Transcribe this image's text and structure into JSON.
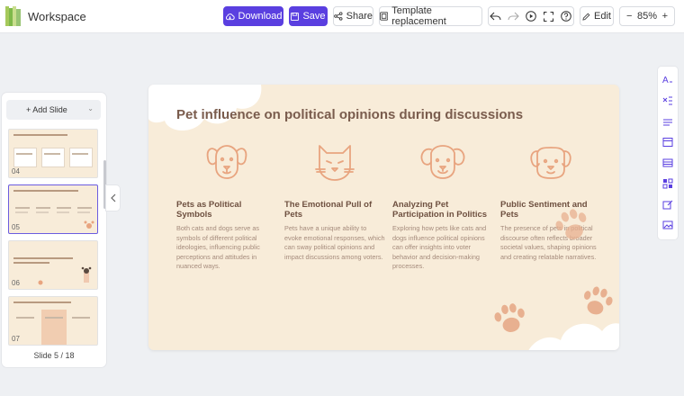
{
  "app": {
    "title": "Workspace"
  },
  "toolbar": {
    "download_label": "Download",
    "save_label": "Save",
    "share_label": "Share",
    "template_label": "Template replacement",
    "edit_label": "Edit",
    "zoom": "85%",
    "zoom_out": "−",
    "zoom_in": "+"
  },
  "sidebar": {
    "add_slide_label": "+ Add Slide",
    "slides": [
      {
        "number": "04",
        "selected": false
      },
      {
        "number": "05",
        "selected": true
      },
      {
        "number": "06",
        "selected": false
      },
      {
        "number": "07",
        "selected": false
      }
    ],
    "counter": "Slide 5 / 18"
  },
  "slide": {
    "title": "Pet influence on political opinions during discussions",
    "columns": [
      {
        "icon": "dog-face-icon",
        "heading": "Pets as Political Symbols",
        "text": "Both cats and dogs serve as symbols of different political ideologies, influencing public perceptions and attitudes in nuanced ways."
      },
      {
        "icon": "cat-face-icon",
        "heading": "The Emotional Pull of Pets",
        "text": "Pets have a unique ability to evoke emotional responses, which can sway political opinions and impact discussions among voters."
      },
      {
        "icon": "puppy-face-icon",
        "heading": "Analyzing Pet Participation in Politics",
        "text": "Exploring how pets like cats and dogs influence political opinions can offer insights into voter behavior and decision-making processes."
      },
      {
        "icon": "pup-face-icon",
        "heading": "Public Sentiment and Pets",
        "text": "The presence of pets in political discourse often reflects broader societal values, shaping opinions and creating relatable narratives."
      }
    ]
  },
  "colors": {
    "primary": "#5a3fe0",
    "slide_bg": "#f8ecd9",
    "title": "#7a5c4d",
    "accent": "#e8a47f"
  }
}
